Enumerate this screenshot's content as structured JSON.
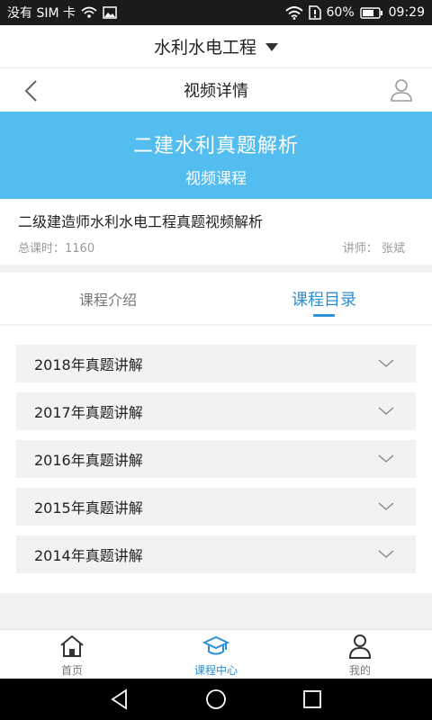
{
  "status_bar": {
    "sim_text": "没有 SIM 卡",
    "battery_percent": "60%",
    "time": "09:29"
  },
  "subject_selector": {
    "label": "水利水电工程"
  },
  "navbar": {
    "title": "视频详情"
  },
  "banner": {
    "title": "二建水利真题解析",
    "subtitle": "视频课程"
  },
  "course": {
    "name": "二级建造师水利水电工程真题视频解析",
    "hours_label": "总课时：",
    "hours_value": "1160",
    "teacher_label": "讲师：",
    "teacher_name": "张斌"
  },
  "tabs": [
    {
      "label": "课程介绍",
      "active": false
    },
    {
      "label": "课程目录",
      "active": true
    }
  ],
  "catalog": [
    {
      "label": "2018年真题讲解"
    },
    {
      "label": "2017年真题讲解"
    },
    {
      "label": "2016年真题讲解"
    },
    {
      "label": "2015年真题讲解"
    },
    {
      "label": "2014年真题讲解"
    }
  ],
  "bottom_tabs": [
    {
      "label": "首页",
      "icon": "home-icon",
      "active": false
    },
    {
      "label": "课程中心",
      "icon": "graduation-cap-icon",
      "active": true
    },
    {
      "label": "我的",
      "icon": "person-icon",
      "active": false
    }
  ],
  "colors": {
    "accent": "#2d8fd6",
    "banner": "#54bdf0"
  }
}
